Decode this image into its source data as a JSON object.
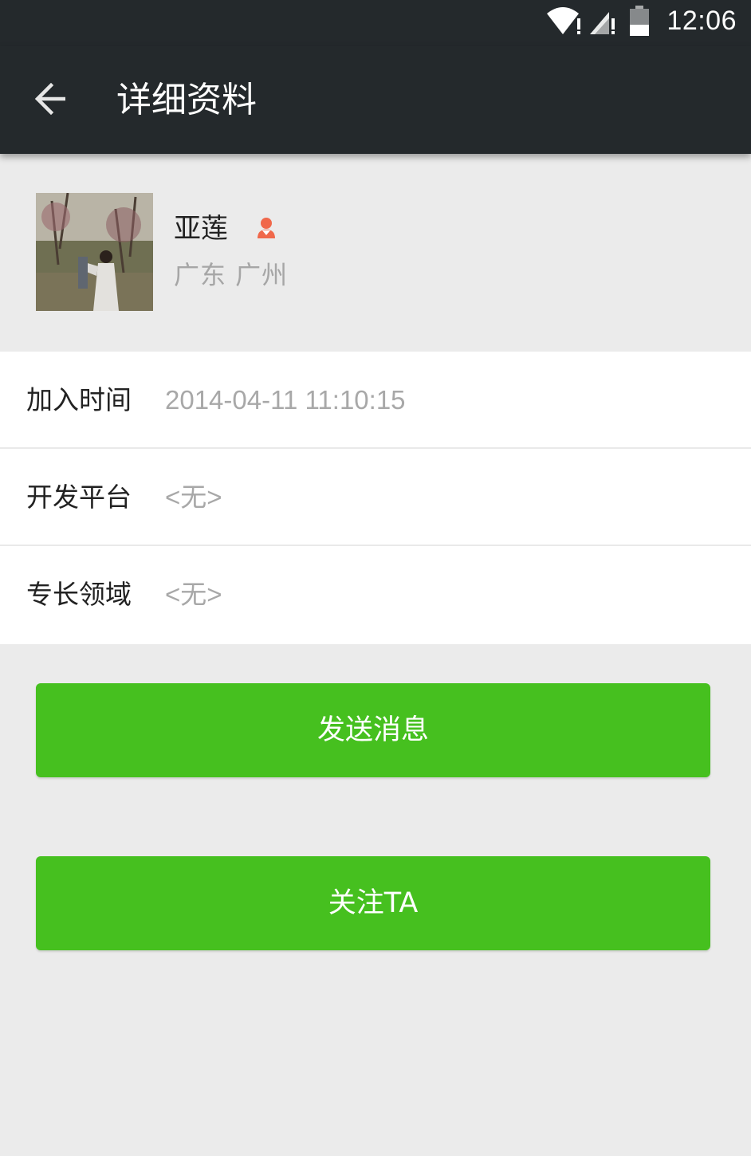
{
  "status_bar": {
    "time": "12:06",
    "icons": [
      "wifi-icon",
      "signal-icon",
      "battery-icon"
    ]
  },
  "app_bar": {
    "back_icon": "arrow-left-icon",
    "title": "详细资料"
  },
  "profile": {
    "name": "亚莲",
    "gender_icon": "female-user-icon",
    "location": "广东 广州"
  },
  "info": {
    "rows": [
      {
        "label": "加入时间",
        "value": "2014-04-11 11:10:15"
      },
      {
        "label": "开发平台",
        "value": "<无>"
      },
      {
        "label": "专长领域",
        "value": "<无>"
      }
    ]
  },
  "actions": {
    "send_message": "发送消息",
    "follow": "关注TA"
  },
  "colors": {
    "toolbar": "#24292c",
    "background": "#ebebeb",
    "primary_button": "#46c01f",
    "gender_icon": "#f0684b"
  }
}
